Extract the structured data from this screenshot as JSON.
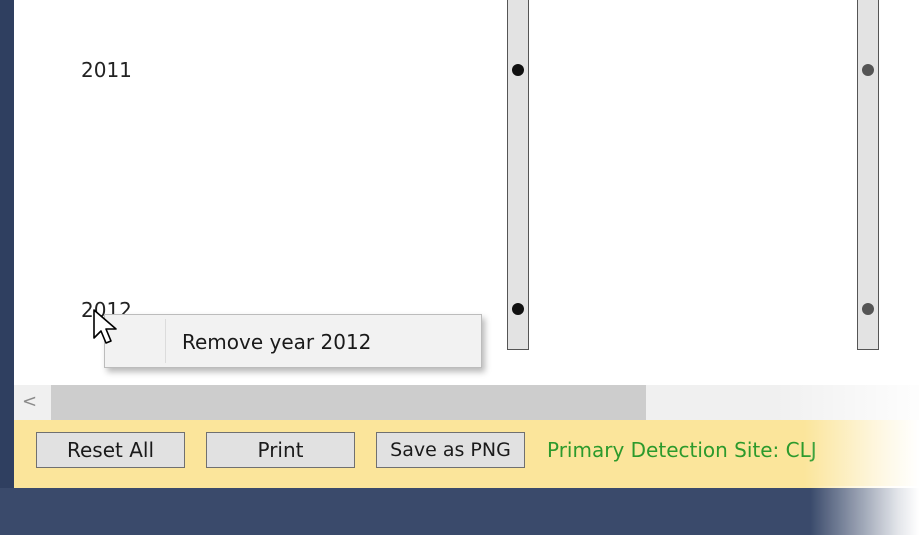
{
  "chart": {
    "years": [
      "2011",
      "2012"
    ]
  },
  "context_menu": {
    "items": [
      {
        "label": "Remove year 2012",
        "icon": "none"
      }
    ]
  },
  "scrollbar": {
    "left_arrow_glyph": "<"
  },
  "toolbar": {
    "reset_label": "Reset All",
    "print_label": "Print",
    "save_png_label": "Save as PNG",
    "status_text": "Primary Detection Site: CLJ"
  },
  "colors": {
    "toolbar_bg": "#fbe59b",
    "status_text": "#2c9a2c",
    "frame": "#2f3f60"
  }
}
